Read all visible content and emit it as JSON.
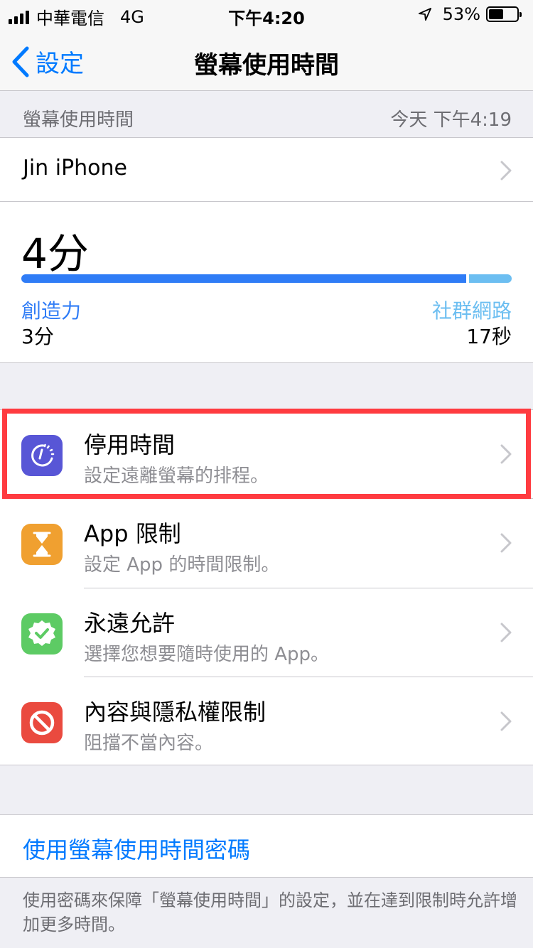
{
  "status_bar": {
    "carrier": "中華電信",
    "network": "4G",
    "time": "下午4:20",
    "battery": "53%",
    "battery_level": 0.53
  },
  "nav": {
    "back_label": "設定",
    "title": "螢幕使用時間"
  },
  "summary_header": {
    "label": "螢幕使用時間",
    "timestamp": "今天 下午4:19"
  },
  "device": {
    "name": "Jin iPhone"
  },
  "usage": {
    "total": "4分",
    "categories": [
      {
        "label": "創造力",
        "value": "3分",
        "seconds": 180,
        "color": "#2f7cf6"
      },
      {
        "label": "社群網路",
        "value": "17秒",
        "seconds": 17,
        "color": "#6cbef1"
      }
    ]
  },
  "list": [
    {
      "title": "停用時間",
      "subtitle": "設定遠離螢幕的排程。",
      "icon": "downtime-icon",
      "color": "#5856d6"
    },
    {
      "title": "App 限制",
      "subtitle": "設定 App 的時間限制。",
      "icon": "hourglass-icon",
      "color": "#f0a030"
    },
    {
      "title": "永遠允許",
      "subtitle": "選擇您想要隨時使用的 App。",
      "icon": "checkmark-badge-icon",
      "color": "#5dcb64"
    },
    {
      "title": "內容與隱私權限制",
      "subtitle": "阻擋不當內容。",
      "icon": "prohibited-icon",
      "color": "#ea4a3f"
    }
  ],
  "passcode": {
    "link": "使用螢幕使用時間密碼",
    "footer": "使用密碼來保障「螢幕使用時間」的設定，並在達到限制時允許增加更多時間。"
  }
}
